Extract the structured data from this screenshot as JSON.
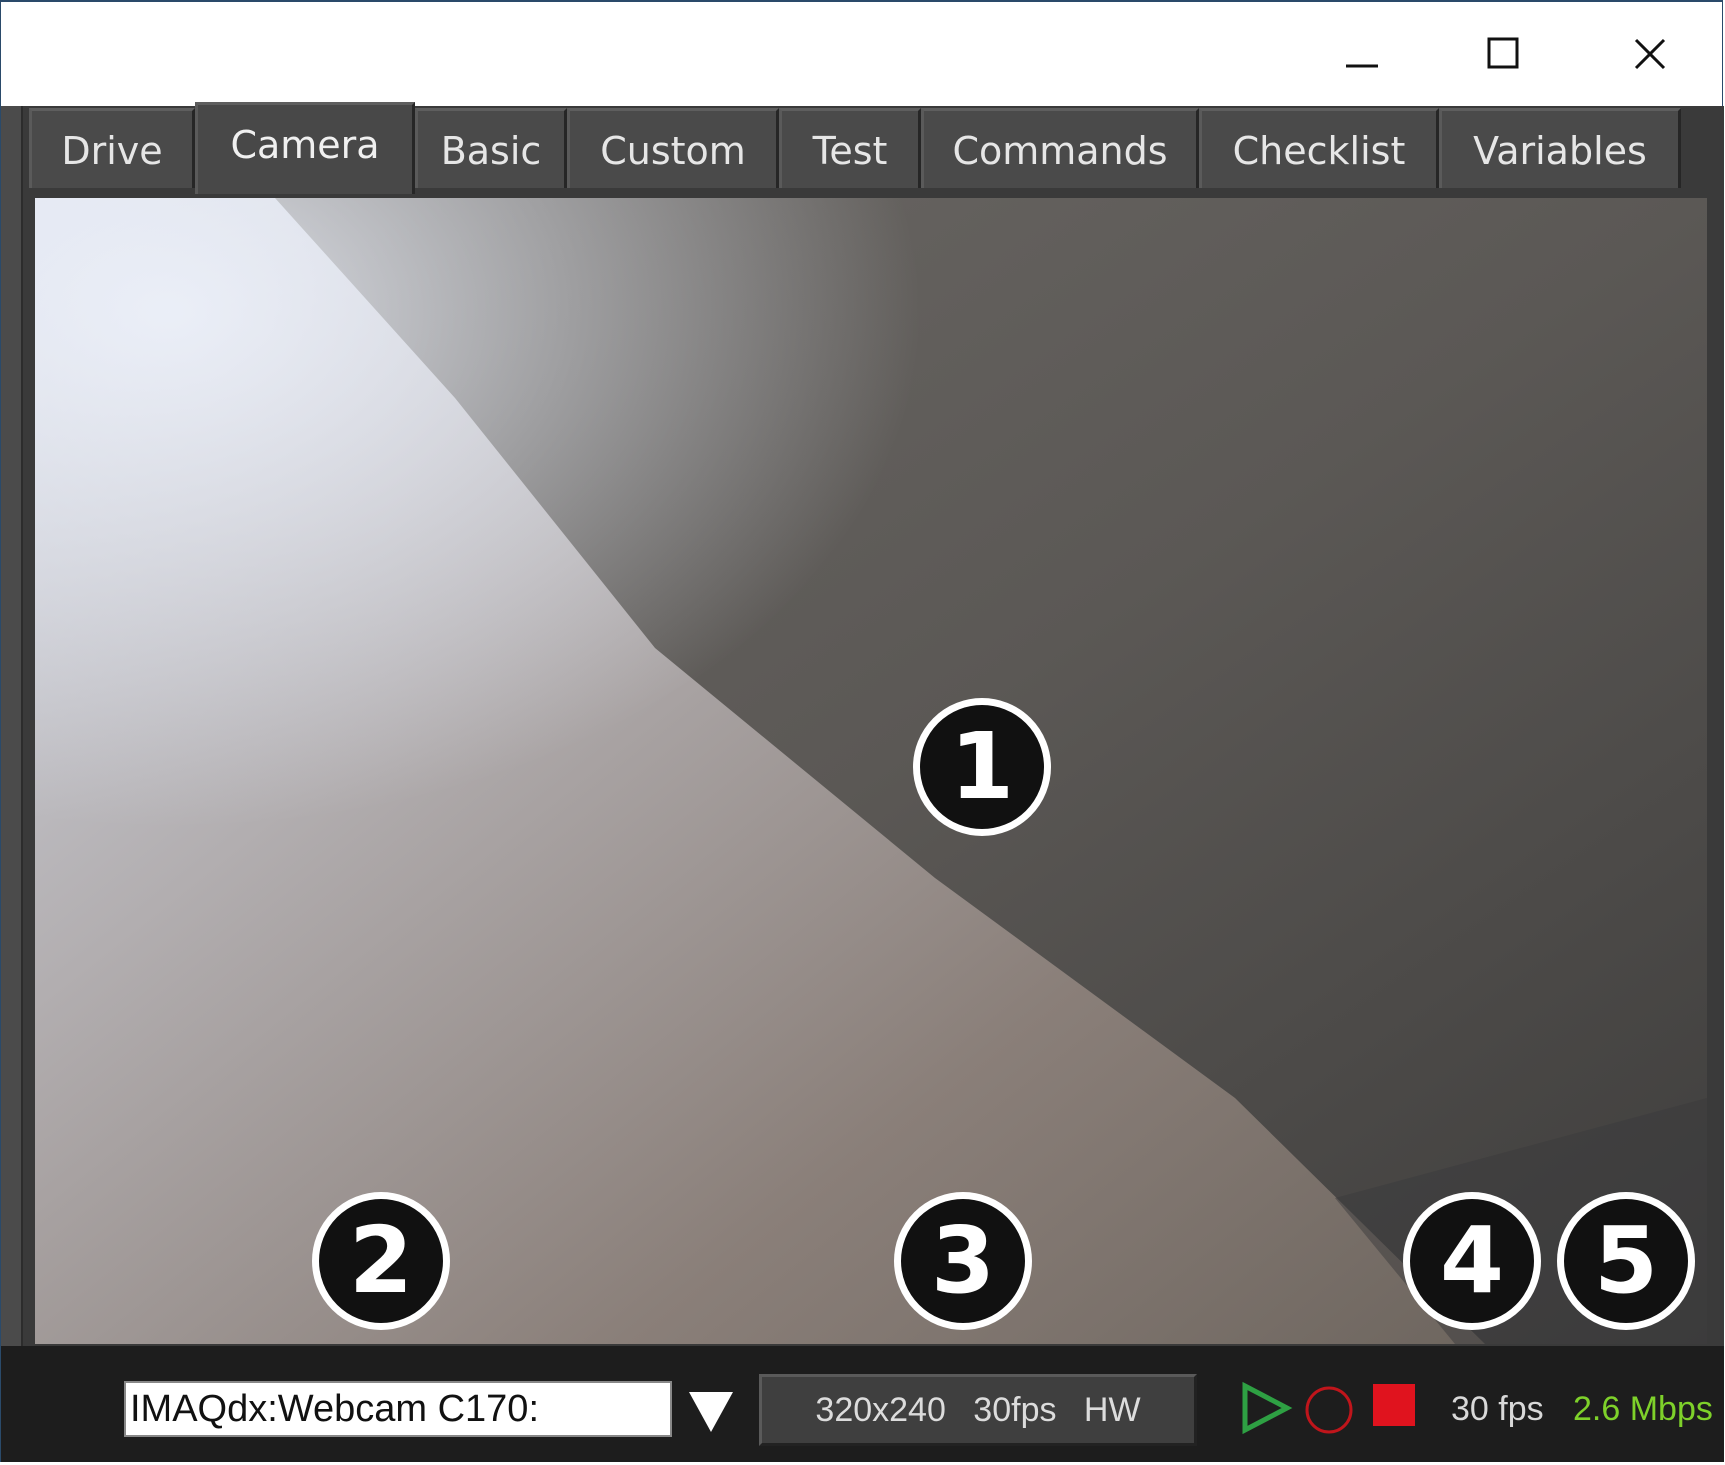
{
  "window": {
    "controls": [
      "minimize-icon",
      "maximize-icon",
      "close-icon"
    ]
  },
  "tabs": [
    {
      "label": "Drive",
      "active": false
    },
    {
      "label": "Camera",
      "active": true
    },
    {
      "label": "Basic",
      "active": false
    },
    {
      "label": "Custom",
      "active": false
    },
    {
      "label": "Test",
      "active": false
    },
    {
      "label": "Commands",
      "active": false
    },
    {
      "label": "Checklist",
      "active": false
    },
    {
      "label": "Variables",
      "active": false
    }
  ],
  "markers": [
    "1",
    "2",
    "3",
    "4",
    "5"
  ],
  "camera": {
    "source": "IMAQdx:Webcam C170:",
    "mode": "320x240 30fps HW",
    "fps": "30 fps",
    "bandwidth": "2.6 Mbps"
  },
  "colors": {
    "play": "#2ea043",
    "record": "#c0151b",
    "stop": "#e0131e",
    "bandwidth": "#7ed12a"
  }
}
